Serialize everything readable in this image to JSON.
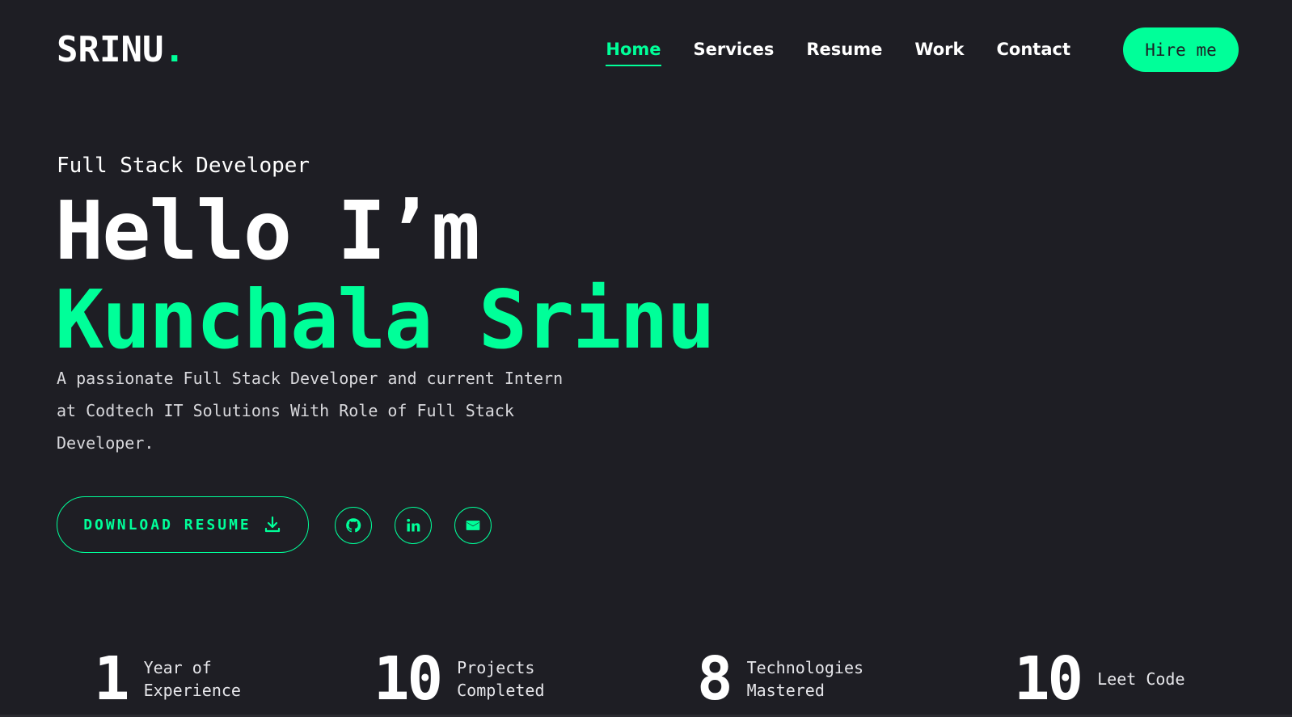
{
  "header": {
    "logo_text": "SRINU",
    "logo_dot": ".",
    "nav": [
      {
        "label": "Home",
        "active": true
      },
      {
        "label": "Services",
        "active": false
      },
      {
        "label": "Resume",
        "active": false
      },
      {
        "label": "Work",
        "active": false
      },
      {
        "label": "Contact",
        "active": false
      }
    ],
    "hire_label": "Hire me"
  },
  "hero": {
    "subtitle": "Full Stack Developer",
    "greeting": "Hello I’m",
    "name": "Kunchala Srinu",
    "description": "A passionate Full Stack Developer and current Intern at Codtech IT Solutions With Role of Full Stack Developer.",
    "download_label": "DOWNLOAD RESUME",
    "socials": [
      {
        "icon": "github-icon"
      },
      {
        "icon": "linkedin-icon"
      },
      {
        "icon": "mail-icon"
      }
    ]
  },
  "stats": [
    {
      "number": "1",
      "label_line1": "Year of",
      "label_line2": "Experience"
    },
    {
      "number": "10",
      "label_line1": "Projects",
      "label_line2": "Completed"
    },
    {
      "number": "8",
      "label_line1": "Technologies",
      "label_line2": "Mastered"
    },
    {
      "number": "10",
      "label_line1": "Leet Code",
      "label_line2": ""
    }
  ],
  "colors": {
    "background": "#1e1e24",
    "accent": "#00ff99",
    "text": "#ffffff"
  }
}
